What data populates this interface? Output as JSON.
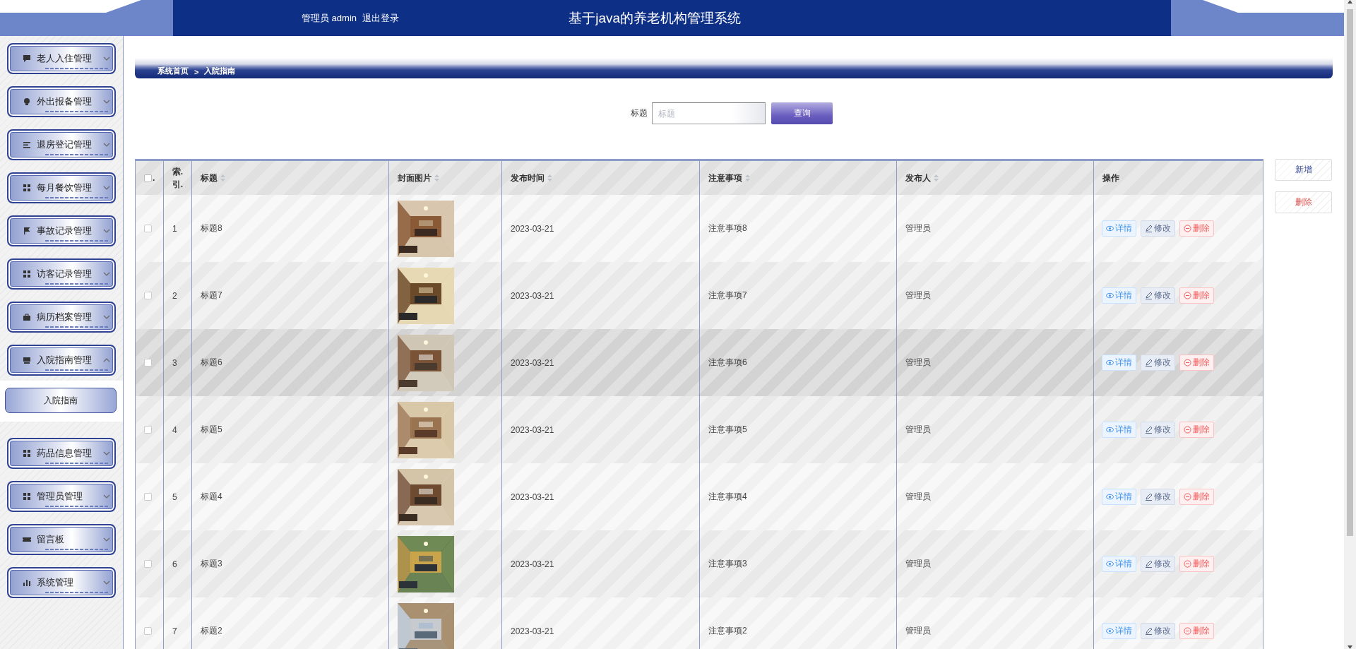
{
  "header": {
    "user_label": "管理员 admin",
    "logout": "退出登录",
    "title": "基于java的养老机构管理系统"
  },
  "sidebar": {
    "items": [
      {
        "label": "老人入住管理",
        "expanded": false
      },
      {
        "label": "外出报备管理",
        "expanded": false
      },
      {
        "label": "退房登记管理",
        "expanded": false
      },
      {
        "label": "每月餐饮管理",
        "expanded": false
      },
      {
        "label": "事故记录管理",
        "expanded": false
      },
      {
        "label": "访客记录管理",
        "expanded": false
      },
      {
        "label": "病历档案管理",
        "expanded": false
      },
      {
        "label": "入院指南管理",
        "expanded": true,
        "children": [
          {
            "label": "入院指南",
            "selected": true
          }
        ]
      },
      {
        "label": "药品信息管理",
        "expanded": false
      },
      {
        "label": "管理员管理",
        "expanded": false
      },
      {
        "label": "留言板",
        "expanded": false
      },
      {
        "label": "系统管理",
        "expanded": false
      }
    ]
  },
  "breadcrumb": {
    "items": [
      "系统首页",
      "入院指南"
    ],
    "separator": ">"
  },
  "search": {
    "label": "标题",
    "placeholder": "标题",
    "button": "查询"
  },
  "actions": [
    {
      "label": "新增",
      "kind": "add"
    },
    {
      "label": "删除",
      "kind": "delete"
    }
  ],
  "table": {
    "columns": [
      {
        "kind": "checkbox",
        "label": ".",
        "checked": false
      },
      {
        "kind": "index",
        "label": "索.\n引.",
        "sortable": false
      },
      {
        "kind": "text",
        "label": "标题",
        "sortable": true
      },
      {
        "label": "封面图片",
        "sortable": true
      },
      {
        "kind": "text",
        "label": "发布时间",
        "sortable": true
      },
      {
        "kind": "text",
        "label": "注意事项",
        "sortable": true
      },
      {
        "kind": "text",
        "label": "发布人",
        "sortable": true
      },
      {
        "kind": "actions",
        "label": "操作",
        "sortable": false
      }
    ],
    "rows": [
      {
        "checked": false,
        "hovered": false,
        "index": "1",
        "title": "标题8",
        "date": "2023-03-21",
        "notes": "注意事项8",
        "publisher": "管理员",
        "actions": [
          {
            "label": "详情",
            "kind": "detail"
          },
          {
            "label": "修改",
            "kind": "edit"
          },
          {
            "label": "删除",
            "kind": "delete"
          }
        ]
      },
      {
        "checked": false,
        "hovered": false,
        "index": "2",
        "title": "标题7",
        "date": "2023-03-21",
        "notes": "注意事项7",
        "publisher": "管理员",
        "actions": [
          {
            "label": "详情",
            "kind": "detail"
          },
          {
            "label": "修改",
            "kind": "edit"
          },
          {
            "label": "删除",
            "kind": "delete"
          }
        ]
      },
      {
        "checked": false,
        "hovered": true,
        "index": "3",
        "title": "标题6",
        "date": "2023-03-21",
        "notes": "注意事项6",
        "publisher": "管理员",
        "actions": [
          {
            "label": "详情",
            "kind": "detail"
          },
          {
            "label": "修改",
            "kind": "edit"
          },
          {
            "label": "删除",
            "kind": "delete"
          }
        ]
      },
      {
        "checked": false,
        "hovered": false,
        "index": "4",
        "title": "标题5",
        "date": "2023-03-21",
        "notes": "注意事项5",
        "publisher": "管理员",
        "actions": [
          {
            "label": "详情",
            "kind": "detail"
          },
          {
            "label": "修改",
            "kind": "edit"
          },
          {
            "label": "删除",
            "kind": "delete"
          }
        ]
      },
      {
        "checked": false,
        "hovered": false,
        "index": "5",
        "title": "标题4",
        "date": "2023-03-21",
        "notes": "注意事项4",
        "publisher": "管理员",
        "actions": [
          {
            "label": "详情",
            "kind": "detail"
          },
          {
            "label": "修改",
            "kind": "edit"
          },
          {
            "label": "删除",
            "kind": "delete"
          }
        ]
      },
      {
        "checked": false,
        "hovered": false,
        "index": "6",
        "title": "标题3",
        "date": "2023-03-21",
        "notes": "注意事项3",
        "publisher": "管理员",
        "actions": [
          {
            "label": "详情",
            "kind": "detail"
          },
          {
            "label": "修改",
            "kind": "edit"
          },
          {
            "label": "删除",
            "kind": "delete"
          }
        ]
      },
      {
        "checked": false,
        "hovered": false,
        "index": "7",
        "title": "标题2",
        "date": "2023-03-21",
        "notes": "注意事项2",
        "publisher": "管理员",
        "actions": [
          {
            "label": "详情",
            "kind": "detail"
          },
          {
            "label": "修改",
            "kind": "edit"
          },
          {
            "label": "删除",
            "kind": "delete"
          }
        ]
      }
    ]
  }
}
